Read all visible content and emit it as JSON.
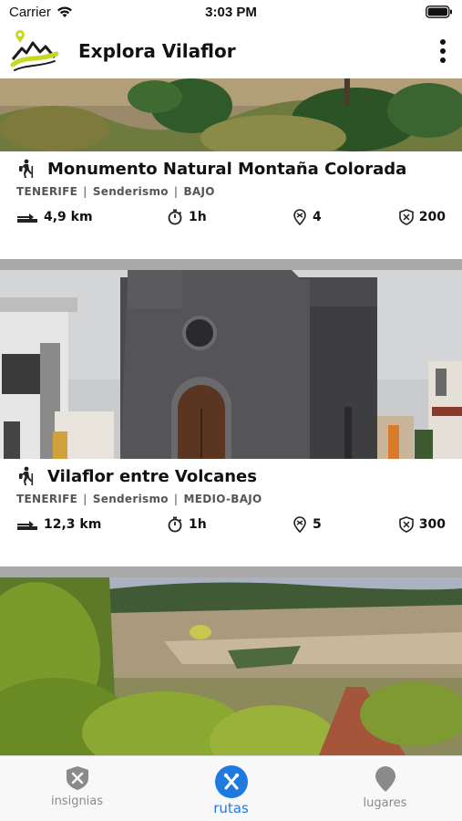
{
  "status_bar": {
    "carrier": "Carrier",
    "time": "3:03 PM"
  },
  "header": {
    "title": "Explora Vilaflor"
  },
  "routes": [
    {
      "title": "Monumento Natural Montaña Colorada",
      "island": "TENERIFE",
      "activity": "Senderismo",
      "difficulty": "BAJO",
      "distance": "4,9 km",
      "duration": "1h",
      "points": "4",
      "score": "200"
    },
    {
      "title": "Vilaflor entre Volcanes",
      "island": "TENERIFE",
      "activity": "Senderismo",
      "difficulty": "MEDIO-BAJO",
      "distance": "12,3 km",
      "duration": "1h",
      "points": "5",
      "score": "300"
    }
  ],
  "tabs": [
    {
      "label": "insignias",
      "icon": "badge-icon",
      "active": false
    },
    {
      "label": "rutas",
      "icon": "hiking-route-icon",
      "active": true
    },
    {
      "label": "lugares",
      "icon": "map-pin-icon",
      "active": false
    }
  ],
  "colors": {
    "accent": "#1f7ae0",
    "divider": "#a9a9a9",
    "inactive": "#8a8a8a"
  }
}
